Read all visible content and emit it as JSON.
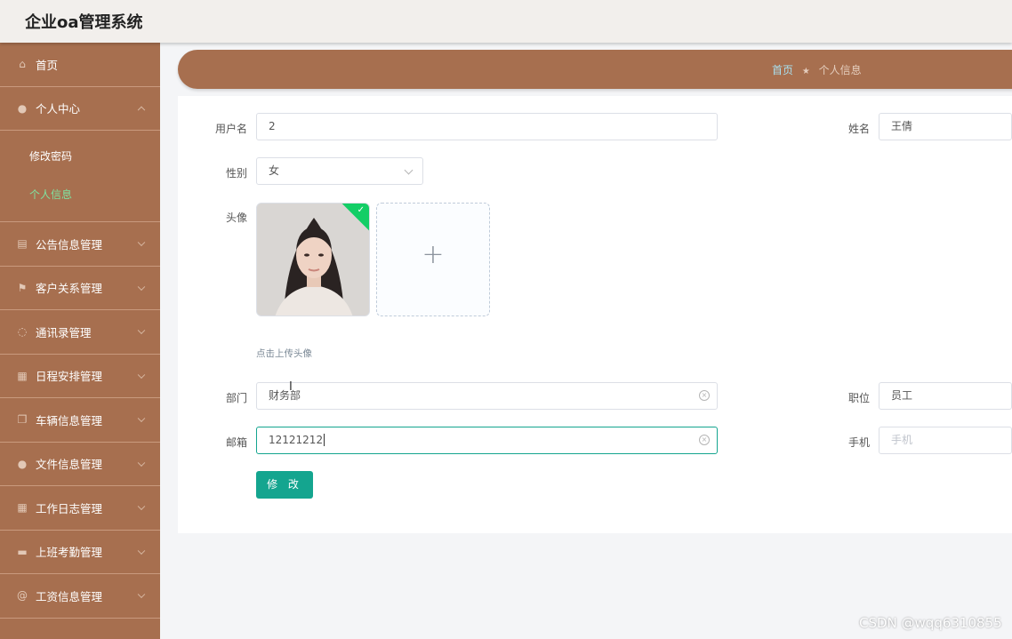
{
  "app": {
    "title": "企业oa管理系统"
  },
  "sidebar": {
    "items": [
      {
        "label": "首页",
        "icon": "home-icon"
      },
      {
        "label": "个人中心",
        "icon": "user-icon"
      },
      {
        "label": "公告信息管理",
        "icon": "clipboard-icon"
      },
      {
        "label": "客户关系管理",
        "icon": "flag-icon"
      },
      {
        "label": "通讯录管理",
        "icon": "globe-icon"
      },
      {
        "label": "日程安排管理",
        "icon": "calendar-icon"
      },
      {
        "label": "车辆信息管理",
        "icon": "copy-icon"
      },
      {
        "label": "文件信息管理",
        "icon": "user-file-icon"
      },
      {
        "label": "工作日志管理",
        "icon": "grid-icon"
      },
      {
        "label": "上班考勤管理",
        "icon": "monitor-icon"
      },
      {
        "label": "工资信息管理",
        "icon": "at-icon"
      }
    ],
    "submenu": [
      {
        "label": "修改密码"
      },
      {
        "label": "个人信息"
      }
    ]
  },
  "breadcrumb": {
    "home": "首页",
    "current": "个人信息"
  },
  "form": {
    "username_label": "用户名",
    "username_value": "2",
    "name_label": "姓名",
    "name_value": "王倩",
    "gender_label": "性别",
    "gender_value": "女",
    "avatar_label": "头像",
    "avatar_hint": "点击上传头像",
    "dept_label": "部门",
    "dept_value": "财务部",
    "position_label": "职位",
    "position_value": "员工",
    "email_label": "邮箱",
    "email_value": "12121212",
    "phone_label": "手机",
    "phone_placeholder": "手机",
    "submit_label": "修 改"
  },
  "watermark": "CSDN @wqq6310855",
  "colors": {
    "sidebar": "#a76f4f",
    "accent": "#14a58f",
    "active_menu": "#7fe3a0"
  }
}
